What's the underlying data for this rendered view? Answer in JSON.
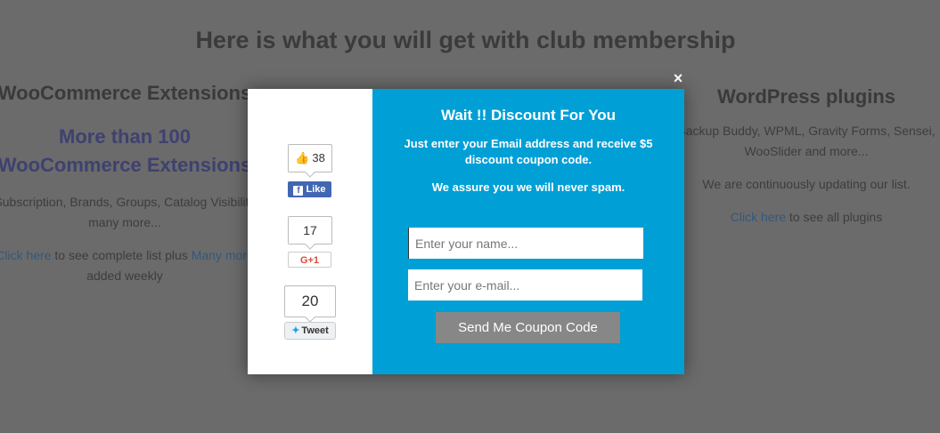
{
  "page": {
    "title": "Here is what you will get with club membership",
    "left": {
      "heading": "WooCommerce Extensions",
      "highlight_line1": "More than 100",
      "highlight_line2": "WooCommerce Extensions",
      "desc_line1": "Subscription, Brands, Groups, Catalog Visibility",
      "desc_line2": "many more...",
      "link_prefix": "Click here",
      "link_suffix": " to see complete list plus ",
      "link_more": "Many more",
      "added": "added weekly"
    },
    "right": {
      "heading": "WordPress plugins",
      "desc_line1": "Backup Buddy, WPML, Gravity Forms, Sensei,",
      "desc_line2": "WooSlider and more...",
      "update": "We are continuously updating our list.",
      "link": "Click here",
      "link_suffix": " to see all plugins"
    }
  },
  "modal": {
    "close": "×",
    "title": "Wait !! Discount For You",
    "subtitle": "Just enter your Email address and receive $5 discount coupon code.",
    "assure": "We assure you we will never spam.",
    "name_placeholder": "Enter your name...",
    "email_placeholder": "Enter your e-mail...",
    "send_label": "Send Me Coupon Code"
  },
  "social": {
    "facebook": {
      "count": "38",
      "label": "Like"
    },
    "googleplus": {
      "count": "17",
      "label": "G+1"
    },
    "twitter": {
      "count": "20",
      "label": "Tweet"
    }
  },
  "colors": {
    "overlay": "#6b6b6b",
    "modal_accent": "#009fd6",
    "button": "#878787",
    "facebook": "#4267b2"
  }
}
